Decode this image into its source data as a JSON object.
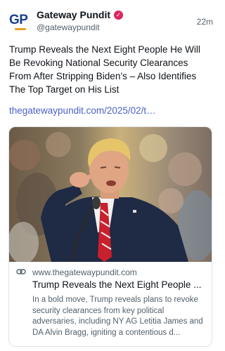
{
  "post": {
    "author": {
      "logo_text": "GP",
      "display_name": "Gateway Pundit",
      "verified_icon": "verified-badge-icon",
      "handle": "@gatewaypundit"
    },
    "time": "22m",
    "text": "Trump Reveals the Next Eight People He Will Be Revoking National Security Clearances From After Stripping Biden’s – Also Identifies The Top Target on His List",
    "link_text": "thegatewaypundit.com/2025/02/t…"
  },
  "card": {
    "link_icon": "link-icon",
    "domain": "www.thegatewaypundit.com",
    "title": "Trump Reveals the Next Eight People ...",
    "description": "In a bold move, Trump reveals plans to revoke security clearances from key political adversaries, including NY AG Letitia James and DA Alvin Bragg, igniting a contentious d..."
  },
  "colors": {
    "logo": "#1c3f8c",
    "logo_accent": "#e8a020",
    "verified": "#e0245e",
    "link": "#4a62c8",
    "muted": "#53606b"
  }
}
